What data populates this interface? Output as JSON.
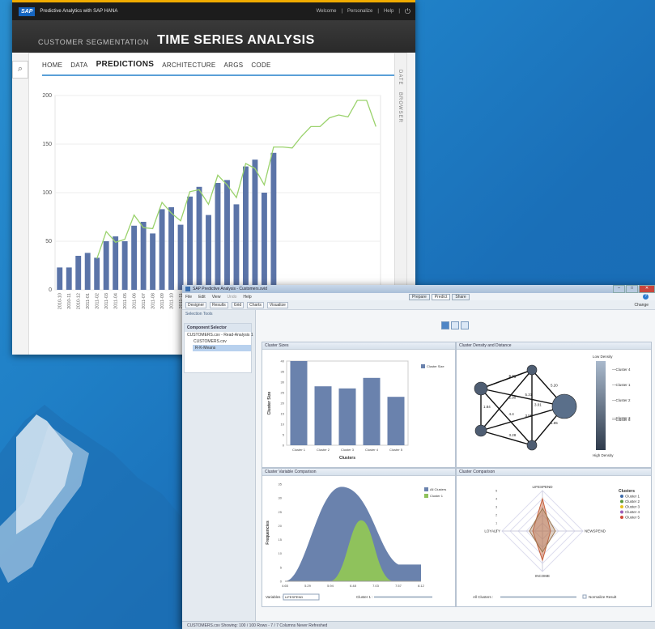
{
  "window1": {
    "app_title": "Predictive Analytics with SAP HANA",
    "logo": "SAP",
    "links": [
      "Welcome",
      "Personalize",
      "Help"
    ],
    "subtitle": "CUSTOMER SEGMENTATION",
    "title": "TIME SERIES ANALYSIS",
    "tabs": [
      "HOME",
      "DATA",
      "PREDICTIONS",
      "ARCHITECTURE",
      "ARGS",
      "CODE"
    ],
    "active_tab": "PREDICTIONS",
    "side_labels": [
      "DATE",
      "BROWSER"
    ]
  },
  "window2": {
    "title": "SAP Predictive Analysis - Customers.svid",
    "menu": [
      "File",
      "Edit",
      "View",
      "Undo",
      "Help"
    ],
    "mode_buttons": [
      "Prepare",
      "Predict",
      "Share"
    ],
    "toolbar": [
      "Designer",
      "Results",
      "Grid",
      "Charts",
      "Visualize"
    ],
    "change_label": "Change",
    "selection_tools": "Selection Tools",
    "component_selector": "Component Selector",
    "tree": [
      "CUSTOMERS.csv - Read-Analysis 1",
      "CUSTOMERS.csv",
      "R-K-Means"
    ],
    "status": "CUSTOMERS.csv    Showing: 100 / 100 Rows - 7 / 7 Columns    Never Refreshed",
    "panel_titles": [
      "Cluster Sizes",
      "Cluster Density and Distance",
      "Cluster Variable Comparison",
      "Cluster Comparison"
    ],
    "density_labels": {
      "low": "Low Density",
      "high": "High Density"
    },
    "variables_label": "Variables :",
    "variables_value": "LIFESPEND",
    "cluster_label": "Cluster 1 :",
    "all_clusters_label": "All Clusters :",
    "normalize_label": "Normalize Result",
    "radar_axes": [
      "LIFESPEND",
      "NEWSPEND",
      "INCOME",
      "LOYALTY"
    ]
  },
  "chart_data": [
    {
      "type": "bar",
      "title": "",
      "categories": [
        "2010-10",
        "2010-11",
        "2010-12",
        "2011-01",
        "2011-02",
        "2011-03",
        "2011-04",
        "2011-05",
        "2011-06",
        "2011-07",
        "2011-08",
        "2011-09",
        "2011-10",
        "2011-11",
        "2011-12",
        "2012-01",
        "2012-02",
        "2012-03",
        "2012-04",
        "2012-05",
        "2012-06",
        "2012-07",
        "2012-08",
        "2012-09",
        "2012-10",
        "2012-11",
        "2012-12",
        "2013-01",
        "2013-02",
        "2013-03",
        "2013-04",
        "2013-05",
        "2013-06",
        "2013-07",
        "2013-08"
      ],
      "series": [
        {
          "kind": "bar",
          "values": [
            23,
            23,
            35,
            38,
            33,
            50,
            55,
            50,
            66,
            70,
            58,
            83,
            85,
            67,
            96,
            106,
            77,
            110,
            113,
            88,
            127,
            134,
            100,
            141,
            null,
            null,
            null,
            null,
            null,
            null,
            null,
            null,
            null,
            null,
            null
          ]
        },
        {
          "kind": "line",
          "values": [
            null,
            null,
            null,
            null,
            null,
            null,
            null,
            null,
            null,
            null,
            null,
            null,
            null,
            null,
            null,
            null,
            null,
            null,
            null,
            null,
            null,
            null,
            null,
            null,
            147,
            146,
            158,
            168,
            168,
            177,
            180,
            178,
            195,
            195,
            168
          ]
        }
      ],
      "fit_line": [
        null,
        null,
        null,
        null,
        32,
        60,
        49,
        52,
        77,
        64,
        63,
        90,
        79,
        71,
        101,
        103,
        88,
        118,
        108,
        95,
        130,
        125,
        108,
        147,
        147,
        146,
        158,
        168,
        168,
        177,
        180,
        178,
        195,
        195,
        168
      ],
      "ylim": [
        0,
        200
      ],
      "yticks": [
        0,
        50,
        100,
        150,
        200
      ]
    },
    {
      "type": "bar",
      "title": "Cluster Sizes",
      "categories": [
        "Cluster 1",
        "Cluster 2",
        "Cluster 3",
        "Cluster 4",
        "Cluster 5"
      ],
      "values": [
        40,
        28,
        27,
        32,
        23
      ],
      "xlabel": "Clusters",
      "ylabel": "Cluster Size",
      "ylim": [
        0,
        40
      ],
      "yticks": [
        0,
        5,
        10,
        15,
        20,
        25,
        30,
        35,
        40
      ],
      "legend": [
        "Cluster Size"
      ]
    },
    {
      "type": "area",
      "title": "Cluster Variable Comparison",
      "x_ticks": [
        "4.65",
        "5.29",
        "5.94",
        "6.48",
        "7.03",
        "7.57",
        "8.12"
      ],
      "ylabel": "Frequencies",
      "ylim": [
        0,
        35
      ],
      "yticks": [
        0,
        5,
        10,
        15,
        20,
        25,
        30,
        35
      ],
      "legend": [
        "All Clusters",
        "Cluster 1"
      ],
      "colors": [
        "#6a82ad",
        "#8fc25c"
      ]
    },
    {
      "type": "radar",
      "title": "Cluster Comparison",
      "axes": [
        "LIFESPEND",
        "NEWSPEND",
        "INCOME",
        "LOYALTY"
      ],
      "legend_title": "Clusters",
      "legend": [
        "Cluster 1",
        "Cluster 2",
        "Cluster 3",
        "Cluster 4",
        "Cluster 5"
      ],
      "legend_colors": [
        "#3d6aa8",
        "#5a9a3a",
        "#e8c21c",
        "#9c5cb8",
        "#d04a3a"
      ],
      "ticks": [
        "0",
        "1",
        "2",
        "3",
        "4",
        "5"
      ]
    },
    {
      "type": "network",
      "title": "Cluster Density and Distance",
      "nodes": [
        "Cluster 4",
        "Cluster 1",
        "Cluster 2",
        "Cluster 3",
        "Cluster 5"
      ],
      "edge_labels": [
        "5.79",
        "5.31",
        "1.84",
        "5.20",
        "3.01",
        "2.90",
        "3.55",
        "3.28",
        "1.65",
        "4.4",
        "2.81"
      ]
    }
  ]
}
